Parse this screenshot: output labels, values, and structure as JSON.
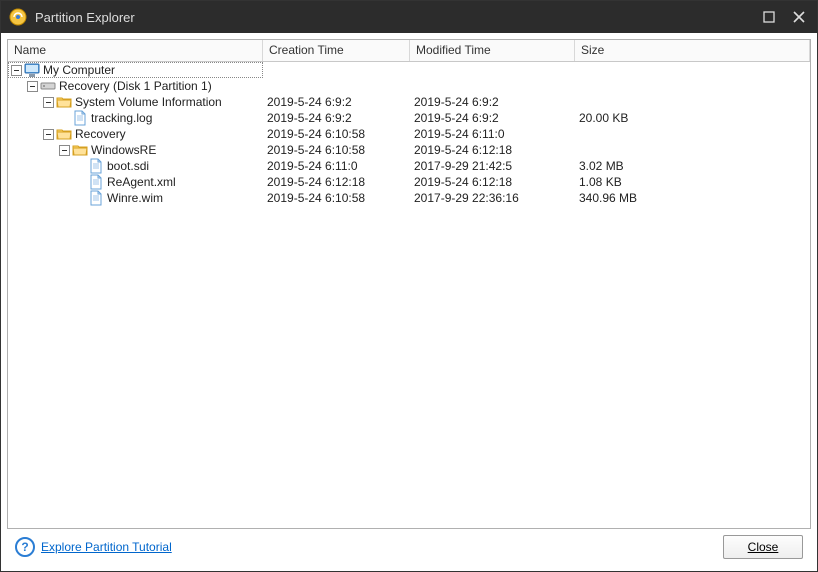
{
  "window": {
    "title": "Partition Explorer"
  },
  "columns": {
    "name": "Name",
    "ctime": "Creation Time",
    "mtime": "Modified Time",
    "size": "Size"
  },
  "tree": {
    "root": {
      "label": "My Computer"
    },
    "partition": {
      "label": "Recovery (Disk 1 Partition 1)"
    },
    "svi": {
      "label": "System Volume Information",
      "ctime": "2019-5-24 6:9:2",
      "mtime": "2019-5-24 6:9:2",
      "size": ""
    },
    "tracking": {
      "label": "tracking.log",
      "ctime": "2019-5-24 6:9:2",
      "mtime": "2019-5-24 6:9:2",
      "size": "20.00 KB"
    },
    "recovery": {
      "label": "Recovery",
      "ctime": "2019-5-24 6:10:58",
      "mtime": "2019-5-24 6:11:0",
      "size": ""
    },
    "windowsre": {
      "label": "WindowsRE",
      "ctime": "2019-5-24 6:10:58",
      "mtime": "2019-5-24 6:12:18",
      "size": ""
    },
    "bootsdi": {
      "label": "boot.sdi",
      "ctime": "2019-5-24 6:11:0",
      "mtime": "2017-9-29 21:42:5",
      "size": "3.02 MB"
    },
    "reagent": {
      "label": "ReAgent.xml",
      "ctime": "2019-5-24 6:12:18",
      "mtime": "2019-5-24 6:12:18",
      "size": "1.08 KB"
    },
    "winre": {
      "label": "Winre.wim",
      "ctime": "2019-5-24 6:10:58",
      "mtime": "2017-9-29 22:36:16",
      "size": "340.96 MB"
    }
  },
  "footer": {
    "tutorial": "Explore Partition Tutorial",
    "close": "Close"
  }
}
